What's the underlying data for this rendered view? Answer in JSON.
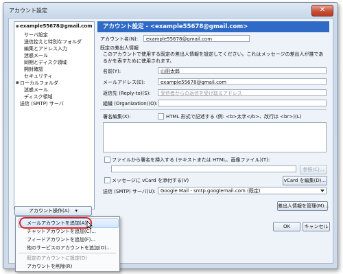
{
  "window": {
    "title": "アカウント設定",
    "close_glyph": "✕"
  },
  "tree": {
    "account": "example55678@gmail.com",
    "items": [
      "サーバ設定",
      "送信控えと特別なフォルダ",
      "編集とアドレス入力",
      "迷惑メール",
      "同期とディスク領域",
      "開封確認",
      "セキュリティ"
    ],
    "local_folders": "ローカルフォルダ",
    "local_items": [
      "迷惑メール",
      "ディスク領域"
    ],
    "smtp": "送信 (SMTP) サーバ"
  },
  "account_actions": {
    "label": "アカウント操作(A)",
    "arrow": "▾"
  },
  "header": {
    "title": "アカウント設定 - <example55678@gmail.com>"
  },
  "form": {
    "account_name_label": "アカウント名(N):",
    "account_name_value": "example55678@gmail.com",
    "default_identity_label": "既定の差出人情報",
    "description": "このアカウントで使用する既定の差出人情報を設定してください。これはメッセージの差出人が誰であるかを表すために使用されます。",
    "name_label": "名前(Y):",
    "name_value": "山田太郎",
    "email_label": "メールアドレス(E):",
    "email_value": "example55678@gmail.com",
    "replyto_label": "返信先 (Reply-to)(S):",
    "replyto_placeholder": "受信者からの返信を受け取るアドレス",
    "org_label": "組織 (Organization)(O):",
    "sig_label": "署名編集(X):",
    "html_check_label": "HTML 形式で記述する (例: <b>太字</b>、改行は <br>)(L)",
    "attach_sig_label": "ファイルから署名を挿入する (テキストまたは HTML、画像ファイル)(T):",
    "browse_label": "参照(C)...",
    "vcard_check_label": "メッセージに vCard を添付する(V)",
    "vcard_edit_label": "vCard を編集(D)...",
    "smtp_label": "送信 (SMTP) サーバ(U):",
    "smtp_value": "Google Mail - smtp.googlemail.com (既定)",
    "manage_identities_label": "差出人情報を管理(M)...",
    "ok_label": "OK",
    "cancel_label": "キャンセル"
  },
  "menu": {
    "items": [
      "メールアカウントを追加(A)...",
      "チャットアカウントを追加(C)...",
      "フィードアカウントを追加(F)...",
      "他のサービスのアカウントを追加(O)..."
    ],
    "disabled": [
      "既定のアカウントに設定(D)"
    ],
    "remove": "アカウントを削除(R)"
  },
  "colors": {
    "header_bg": "#2f6bc6",
    "highlight_ring": "#e02020",
    "close_button": "#c8523a"
  }
}
